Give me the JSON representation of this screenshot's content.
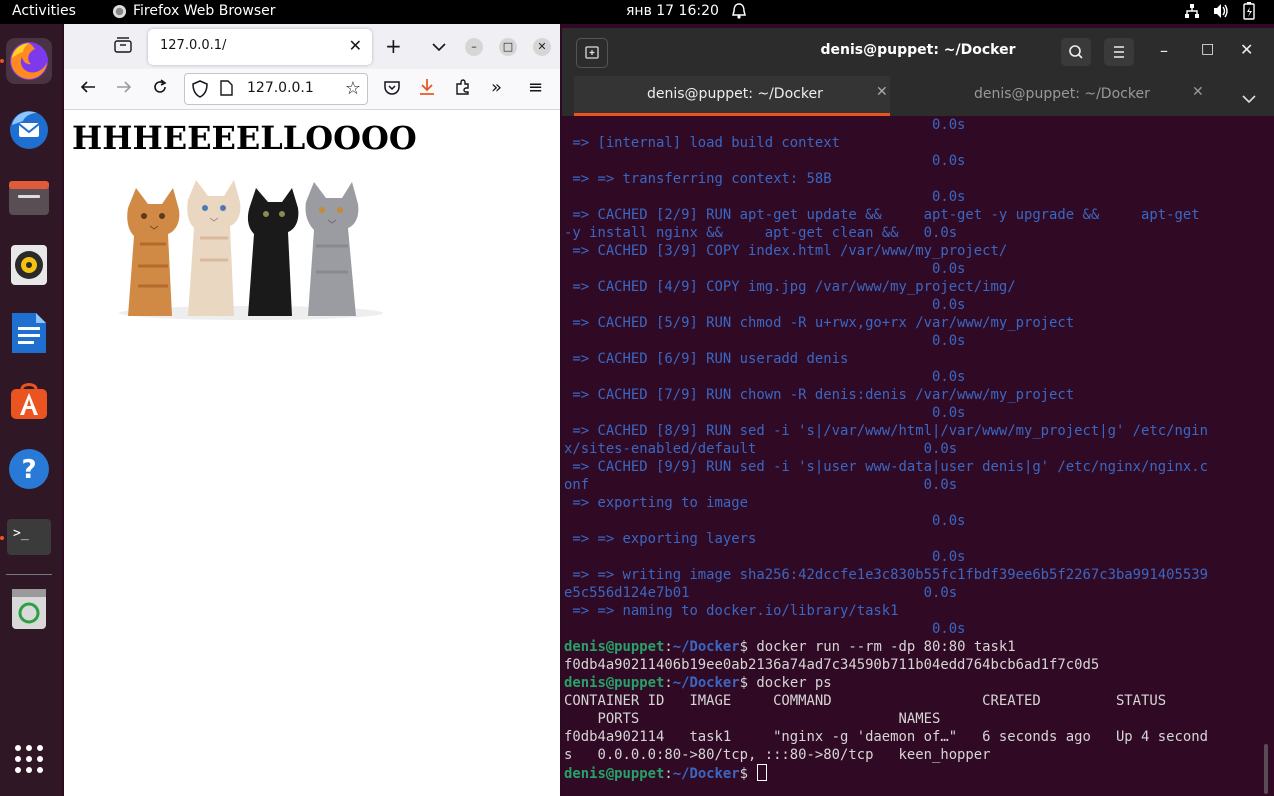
{
  "topbar": {
    "activities": "Activities",
    "app_name": "Firefox Web Browser",
    "clock": "янв 17  16:20"
  },
  "firefox": {
    "tab_title": "127.0.0.1/",
    "url": "127.0.0.1",
    "page_heading": "HHHEEEELLOOOO"
  },
  "terminal": {
    "title": "denis@puppet: ~/Docker",
    "tabs": [
      "denis@puppet: ~/Docker",
      "denis@puppet: ~/Docker"
    ],
    "user_host": "denis@puppet",
    "path": "~/Docker",
    "lines": [
      {
        "type": "dim",
        "text": "                                            0.0s"
      },
      {
        "type": "dim",
        "text": " => [internal] load build context"
      },
      {
        "type": "dim",
        "text": "                                            0.0s"
      },
      {
        "type": "dim",
        "text": " => => transferring context: 58B"
      },
      {
        "type": "dim",
        "text": "                                            0.0s"
      },
      {
        "type": "dim",
        "text": " => CACHED [2/9] RUN apt-get update &&     apt-get -y upgrade &&     apt-get"
      },
      {
        "type": "dim",
        "text": "-y install nginx &&     apt-get clean &&   0.0s"
      },
      {
        "type": "dim",
        "text": " => CACHED [3/9] COPY index.html /var/www/my_project/"
      },
      {
        "type": "dim",
        "text": "                                            0.0s"
      },
      {
        "type": "dim",
        "text": " => CACHED [4/9] COPY img.jpg /var/www/my_project/img/"
      },
      {
        "type": "dim",
        "text": "                                            0.0s"
      },
      {
        "type": "dim",
        "text": " => CACHED [5/9] RUN chmod -R u+rwx,go+rx /var/www/my_project"
      },
      {
        "type": "dim",
        "text": "                                            0.0s"
      },
      {
        "type": "dim",
        "text": " => CACHED [6/9] RUN useradd denis"
      },
      {
        "type": "dim",
        "text": "                                            0.0s"
      },
      {
        "type": "dim",
        "text": " => CACHED [7/9] RUN chown -R denis:denis /var/www/my_project"
      },
      {
        "type": "dim",
        "text": "                                            0.0s"
      },
      {
        "type": "dim",
        "text": " => CACHED [8/9] RUN sed -i 's|/var/www/html|/var/www/my_project|g' /etc/ngin"
      },
      {
        "type": "dim",
        "text": "x/sites-enabled/default                    0.0s"
      },
      {
        "type": "dim",
        "text": " => CACHED [9/9] RUN sed -i 's|user www-data|user denis|g' /etc/nginx/nginx.c"
      },
      {
        "type": "dim",
        "text": "onf                                        0.0s"
      },
      {
        "type": "dim",
        "text": " => exporting to image"
      },
      {
        "type": "dim",
        "text": "                                            0.0s"
      },
      {
        "type": "dim",
        "text": " => => exporting layers"
      },
      {
        "type": "dim",
        "text": "                                            0.0s"
      },
      {
        "type": "dim",
        "text": " => => writing image sha256:42dccfe1e3c830b55fc1fbdf39ee6b5f2267c3ba991405539"
      },
      {
        "type": "dim",
        "text": "e5c556d124e7b01                            0.0s"
      },
      {
        "type": "dim",
        "text": " => => naming to docker.io/library/task1"
      },
      {
        "type": "dim",
        "text": "                                            0.0s"
      },
      {
        "type": "prompt",
        "text": " docker run --rm -dp 80:80 task1"
      },
      {
        "type": "out",
        "text": "f0db4a90211406b19ee0ab2136a74ad7c34590b711b04edd764bcb6ad1f7c0d5"
      },
      {
        "type": "prompt",
        "text": " docker ps"
      },
      {
        "type": "out",
        "text": "CONTAINER ID   IMAGE     COMMAND                  CREATED         STATUS"
      },
      {
        "type": "out",
        "text": "    PORTS                               NAMES"
      },
      {
        "type": "out",
        "text": "f0db4a902114   task1     \"nginx -g 'daemon of…\"   6 seconds ago   Up 4 second"
      },
      {
        "type": "out",
        "text": "s   0.0.0.0:80->80/tcp, :::80->80/tcp   keen_hopper"
      },
      {
        "type": "prompt",
        "text": " "
      }
    ]
  }
}
